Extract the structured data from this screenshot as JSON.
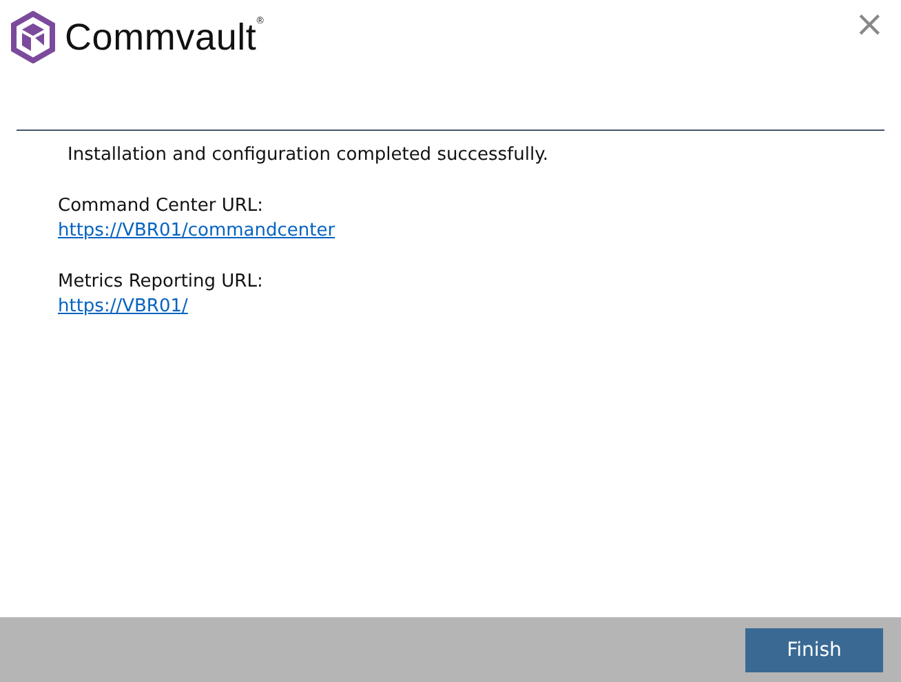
{
  "logo": {
    "name": "Commvault",
    "mark": "®"
  },
  "close": "×",
  "message": "Installation and configuration completed successfully.",
  "links": [
    {
      "label": "Command Center URL:",
      "url": "https://VBR01/commandcenter"
    },
    {
      "label": "Metrics Reporting URL:",
      "url": "https://VBR01/"
    }
  ],
  "buttons": [
    "Finish"
  ]
}
